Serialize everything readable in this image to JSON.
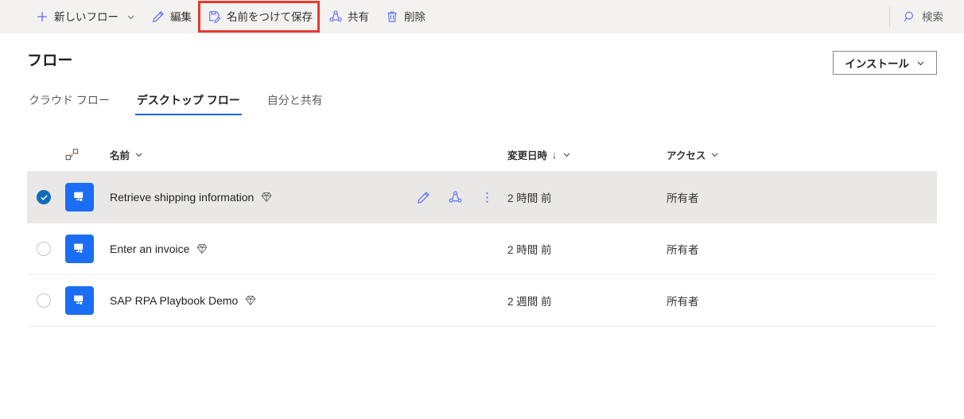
{
  "command_bar": {
    "buttons": [
      {
        "id": "new-flow",
        "icon": "plus-icon",
        "label": "新しいフロー",
        "chevron": true
      },
      {
        "id": "edit",
        "icon": "pencil-icon",
        "label": "編集",
        "chevron": false
      },
      {
        "id": "save-as",
        "icon": "save-as-icon",
        "label": "名前をつけて保存",
        "chevron": false,
        "highlighted": true
      },
      {
        "id": "share",
        "icon": "share-icon",
        "label": "共有",
        "chevron": false
      },
      {
        "id": "delete",
        "icon": "trash-icon",
        "label": "削除",
        "chevron": false
      }
    ],
    "search": {
      "icon": "search-icon",
      "label": "検索"
    },
    "highlight_color": "#e8392c"
  },
  "header": {
    "title": "フロー",
    "install_button": {
      "label": "インストール",
      "icon": "chevron-down-icon"
    }
  },
  "tabs": [
    {
      "id": "cloud-flows",
      "label": "クラウド フロー",
      "selected": false
    },
    {
      "id": "desktop-flows",
      "label": "デスクトップ フロー",
      "selected": true
    },
    {
      "id": "shared-with-me",
      "label": "自分と共有",
      "selected": false
    }
  ],
  "table": {
    "columns": {
      "type": {
        "icon": "flow-link-icon"
      },
      "name": {
        "label": "名前",
        "sortable": true
      },
      "modified": {
        "label": "変更日時",
        "sortable": true,
        "sort_direction": "↓"
      },
      "access": {
        "label": "アクセス",
        "sortable": true
      }
    },
    "rows": [
      {
        "name": "Retrieve shipping information",
        "premium": true,
        "modified": "2 時間 前",
        "access": "所有者",
        "selected": true,
        "show_actions": true,
        "actions": [
          {
            "id": "edit-flow",
            "icon": "pencil-icon"
          },
          {
            "id": "share-flow",
            "icon": "share-icon"
          },
          {
            "id": "more-flow",
            "icon": "more-vertical-icon"
          }
        ]
      },
      {
        "name": "Enter an invoice",
        "premium": true,
        "modified": "2 時間 前",
        "access": "所有者",
        "selected": false,
        "show_actions": false
      },
      {
        "name": "SAP RPA Playbook Demo",
        "premium": true,
        "modified": "2 週間 前",
        "access": "所有者",
        "selected": false,
        "show_actions": false
      }
    ]
  },
  "colors": {
    "accent_blue": "#1b6ef3",
    "tab_underline": "#1267d6",
    "icon_blue": "#5b6ef5",
    "command_bar_bg": "#f3f2f1",
    "selected_row_bg": "#e9e8e7",
    "highlight_red": "#e8392c"
  }
}
